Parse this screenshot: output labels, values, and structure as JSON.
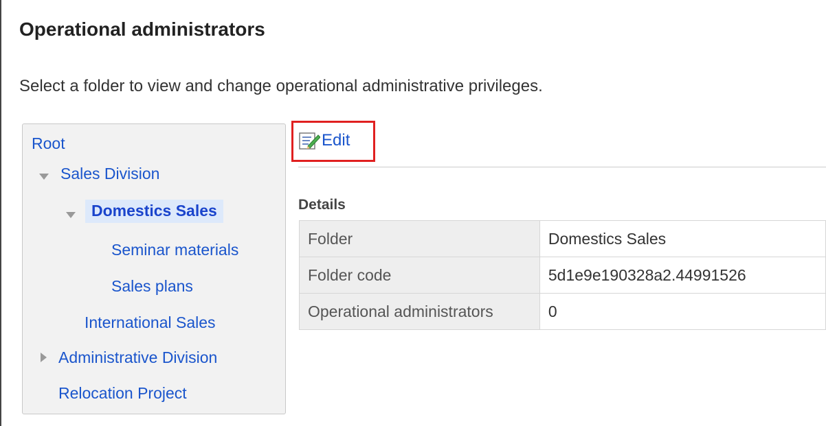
{
  "page": {
    "title": "Operational administrators",
    "description": "Select a folder to view and change operational administrative privileges."
  },
  "tree": {
    "items": [
      {
        "label": "Root"
      },
      {
        "label": "Sales Division",
        "toggle": "expanded"
      },
      {
        "label": "Domestics Sales",
        "toggle": "expanded",
        "selected": true
      },
      {
        "label": "Seminar materials"
      },
      {
        "label": "Sales plans"
      },
      {
        "label": "International Sales"
      },
      {
        "label": "Administrative Division",
        "toggle": "collapsed"
      },
      {
        "label": "Relocation Project"
      }
    ]
  },
  "toolbar": {
    "edit_label": "Edit",
    "edit_icon": "edit-pencil-icon",
    "highlight_color": "#e02020"
  },
  "details": {
    "heading": "Details",
    "rows": [
      {
        "label": "Folder",
        "value": "Domestics Sales"
      },
      {
        "label": "Folder code",
        "value": "5d1e9e190328a2.44991526"
      },
      {
        "label": "Operational administrators",
        "value": "0"
      }
    ]
  },
  "colors": {
    "link": "#1a55cc",
    "panel_bg": "#f2f2f2",
    "selected_bg": "#dde9fb"
  }
}
